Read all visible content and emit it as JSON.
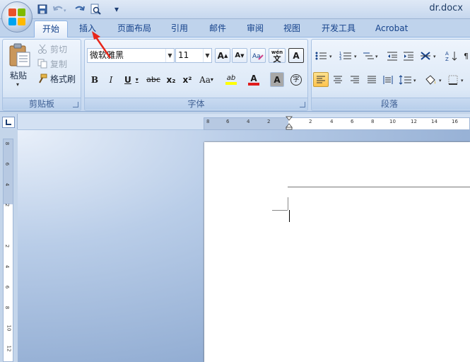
{
  "window": {
    "title": "dr.docx"
  },
  "qat": {
    "save_icon": "save-icon",
    "undo_icon": "undo-icon",
    "redo_icon": "redo-icon",
    "preview_icon": "print-preview-icon",
    "customize": "▾"
  },
  "tabs": [
    {
      "label": "开始",
      "active": true
    },
    {
      "label": "插入"
    },
    {
      "label": "页面布局"
    },
    {
      "label": "引用"
    },
    {
      "label": "邮件"
    },
    {
      "label": "审阅"
    },
    {
      "label": "视图"
    },
    {
      "label": "开发工具"
    },
    {
      "label": "Acrobat"
    }
  ],
  "clipboard": {
    "paste": "粘贴",
    "cut": "剪切",
    "copy": "复制",
    "format_painter": "格式刷",
    "group_label": "剪贴板"
  },
  "font": {
    "name": "微软雅黑",
    "size": "11",
    "group_label": "字体",
    "bold": "B",
    "italic": "I",
    "underline": "U",
    "strike": "abc",
    "subscript": "x₂",
    "superscript": "x²",
    "change_case": "Aa",
    "grow": "A",
    "shrink": "A",
    "phonetic": "wén",
    "border_char": "A",
    "highlight": "ab",
    "font_color": "A",
    "shade_char": "A",
    "enclose": "字"
  },
  "paragraph": {
    "group_label": "段落"
  },
  "colors": {
    "highlight": "#ffff00",
    "font_color": "#e01c1c",
    "accent": "#15428b"
  }
}
